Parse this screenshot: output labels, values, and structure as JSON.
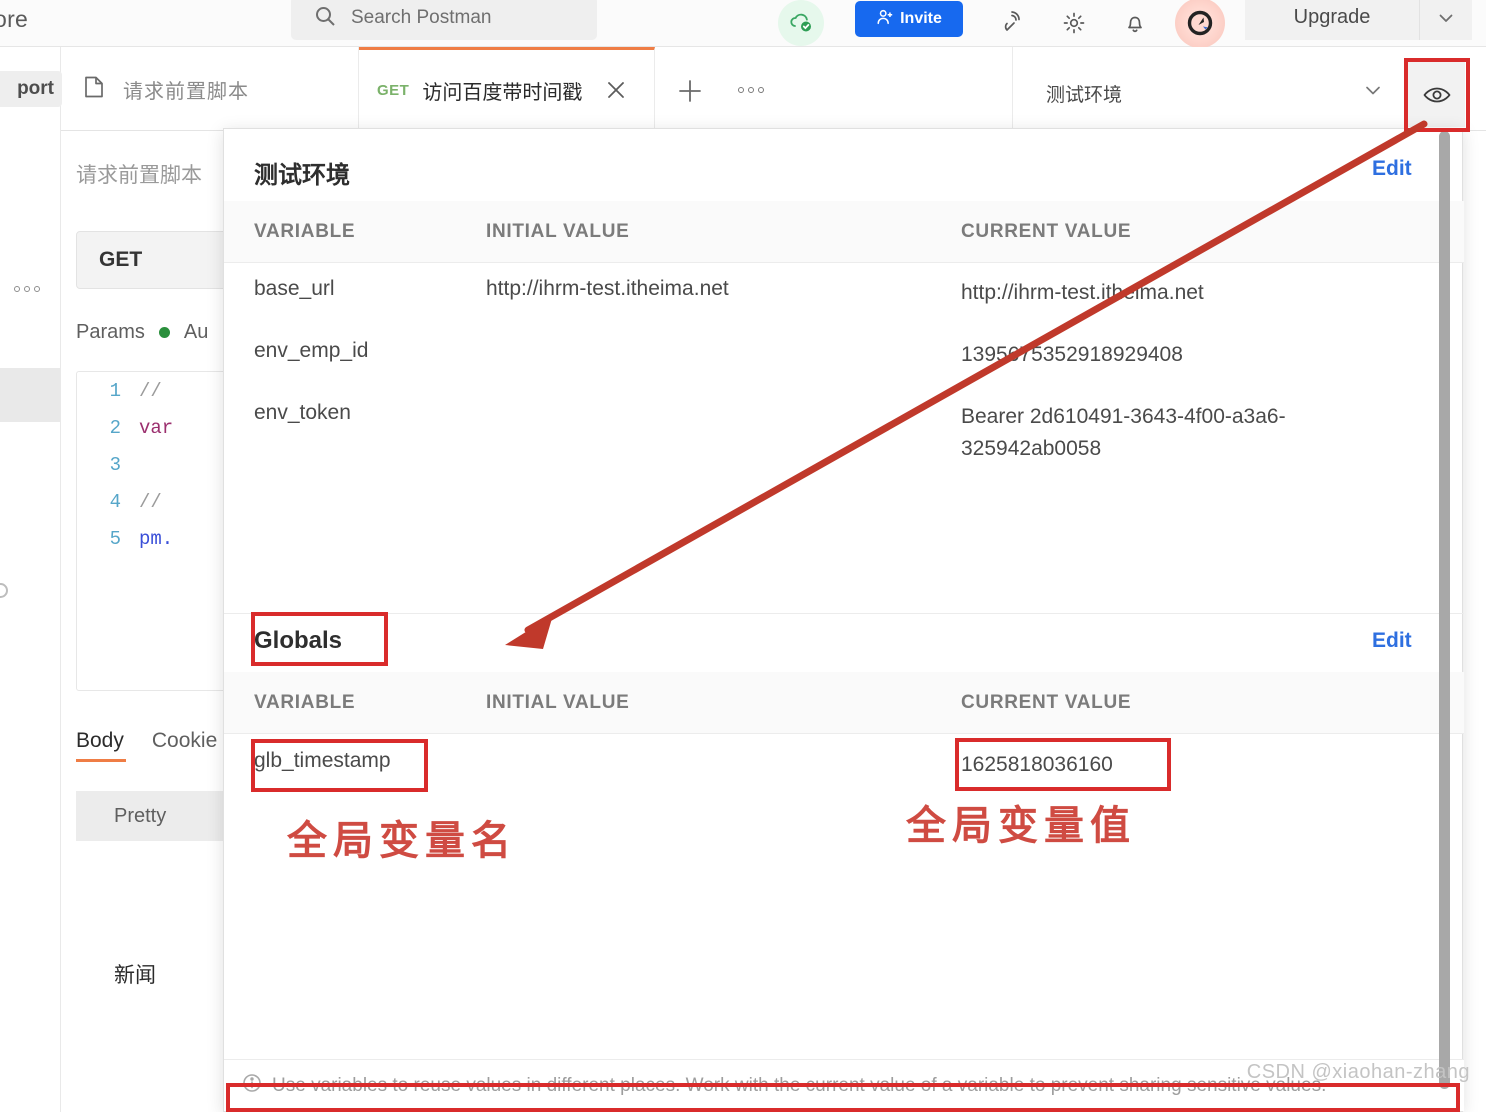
{
  "appbar": {
    "left_partial_label": "ore",
    "search": {
      "placeholder": "Search Postman",
      "icon": "search-icon"
    },
    "cloud_status_icon": "cloud-check-icon",
    "invite_label": "Invite",
    "invite_icon": "person-add-icon",
    "broadcast_icon": "satellite-antenna-icon",
    "settings_icon": "gear-icon",
    "notifications_icon": "bell-icon",
    "avatar_icon": "postman-avatar-icon",
    "upgrade_label": "Upgrade",
    "upgrade_caret_icon": "chevron-down-icon"
  },
  "tabstrip": {
    "left_rail_partial_label": "port",
    "collection_tab": {
      "label": "请求前置脚本",
      "icon": "document-icon"
    },
    "active_tab": {
      "method": "GET",
      "title": "访问百度带时间戳",
      "close_icon": "close-icon"
    },
    "new_tab_icon": "plus-icon",
    "tab_options_icon": "ellipsis-icon",
    "environment": {
      "name": "测试环境",
      "caret_icon": "chevron-down-icon"
    },
    "eye_button_icon": "eye-icon"
  },
  "request_panel": {
    "name": "请求前置脚本",
    "method": "GET",
    "tabs": [
      {
        "label": "Params",
        "has_dot": true
      },
      {
        "label": "Au",
        "has_dot": false
      }
    ],
    "editor_lines": [
      {
        "no": "1",
        "kind": "comment",
        "text": "//"
      },
      {
        "no": "2",
        "kind": "keyword",
        "text": "var"
      },
      {
        "no": "3",
        "kind": "blank",
        "text": ""
      },
      {
        "no": "4",
        "kind": "comment",
        "text": "//"
      },
      {
        "no": "5",
        "kind": "pm",
        "text": "pm."
      }
    ],
    "response_tabs": [
      {
        "label": "Body",
        "active": true
      },
      {
        "label": "Cookie",
        "active": false
      }
    ],
    "view_mode": "Pretty",
    "preview_text": "新闻"
  },
  "sidebar": {
    "options_icon": "ellipsis-icon",
    "selected_item_icon": "selected-row-indicator",
    "circle_icon": "circle-icon"
  },
  "env_popup": {
    "environment_section": {
      "title": "测试环境",
      "edit_label": "Edit",
      "columns": [
        "VARIABLE",
        "INITIAL VALUE",
        "CURRENT VALUE"
      ],
      "rows": [
        {
          "variable": "base_url",
          "initial": "http://ihrm-test.itheima.net",
          "current": "http://ihrm-test.itheima.net"
        },
        {
          "variable": "env_emp_id",
          "initial": "",
          "current": "1395675352918929408"
        },
        {
          "variable": "env_token",
          "initial": "",
          "current": "Bearer 2d610491-3643-4f00-a3a6-325942ab0058"
        }
      ]
    },
    "globals_section": {
      "title": "Globals",
      "edit_label": "Edit",
      "columns": [
        "VARIABLE",
        "INITIAL VALUE",
        "CURRENT VALUE"
      ],
      "rows": [
        {
          "variable": "glb_timestamp",
          "initial": "",
          "current": "1625818036160"
        }
      ]
    },
    "footer": {
      "icon": "info-icon",
      "text": "Use variables to reuse values in different places. Work with the current value of a variable to prevent sharing sensitive values."
    }
  },
  "annotations": {
    "variable_name_note": "全局变量名",
    "variable_value_note": "全局变量值",
    "accent_red": "#d92b2b"
  },
  "watermark": "CSDN @xiaohan-zhang"
}
